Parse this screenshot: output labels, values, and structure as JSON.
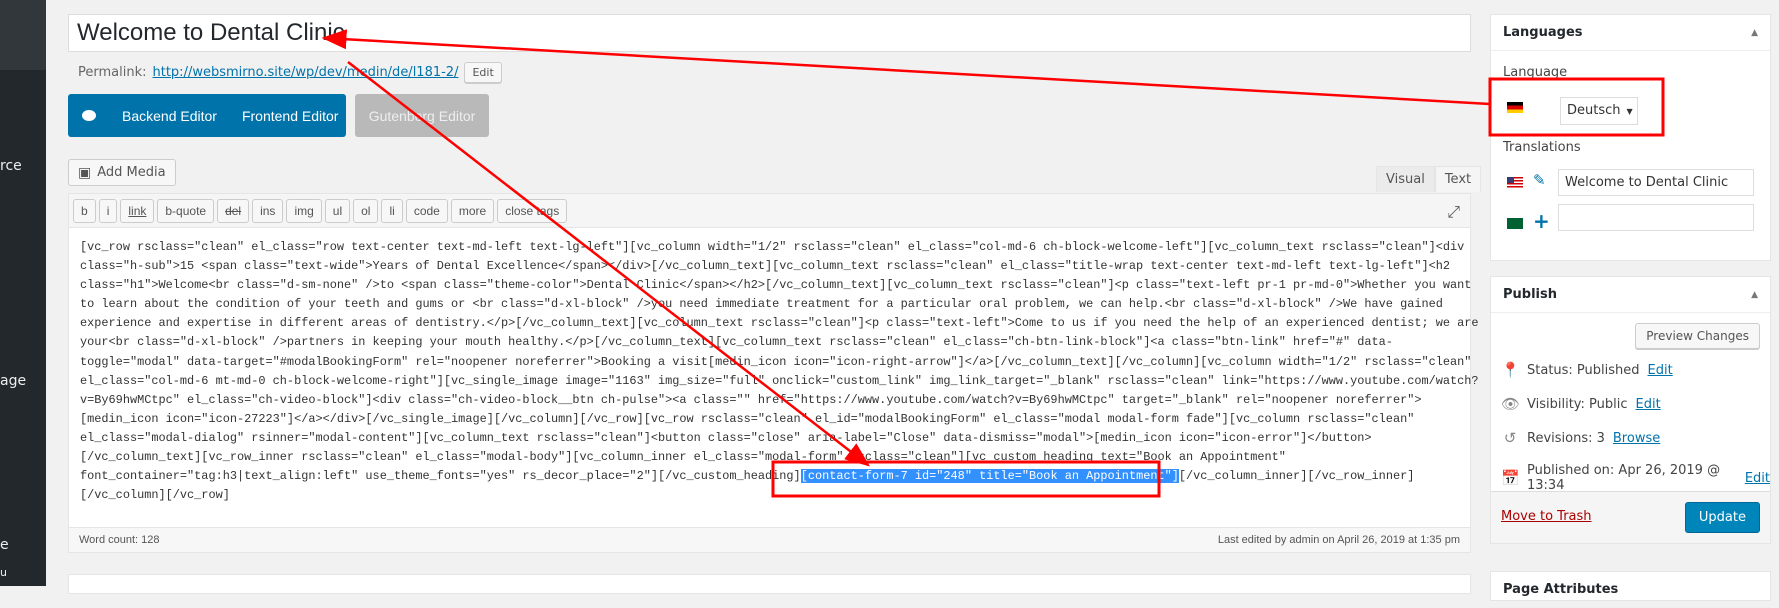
{
  "sidebar": {
    "partial_labels": [
      "rce",
      "age",
      "e",
      "u"
    ]
  },
  "title": {
    "value": "Welcome to Dental Clinic"
  },
  "permalink": {
    "label": "Permalink:",
    "url": "http://websmirno.site/wp/dev/medin/de/l181-2/",
    "edit": "Edit"
  },
  "composer": {
    "backend": "Backend Editor",
    "frontend": "Frontend Editor",
    "gutenberg": "Gutenberg Editor"
  },
  "add_media": "Add Media",
  "tabs": {
    "visual": "Visual",
    "text": "Text"
  },
  "quicktags": [
    "b",
    "i",
    "link",
    "b-quote",
    "del",
    "ins",
    "img",
    "ul",
    "ol",
    "li",
    "code",
    "more",
    "close tags"
  ],
  "content": {
    "lines": [
      "[vc_row rsclass=\"clean\" el_class=\"row text-center text-md-left text-lg-left\"][vc_column width=\"1/2\" rsclass=\"clean\" el_class=\"col-md-6 ch-block-welcome-left\"][vc_column_text rsclass=\"clean\"]<div",
      "class=\"h-sub\">15 <span class=\"text-wide\">Years of Dental Excellence</span></div>[/vc_column_text][vc_column_text rsclass=\"clean\" el_class=\"title-wrap text-center text-md-left text-lg-left\"]<h2",
      "class=\"h1\">Welcome<br class=\"d-sm-none\" />to <span class=\"theme-color\">Dental Clinic</span></h2>[/vc_column_text][vc_column_text rsclass=\"clean\"]<p class=\"text-left pr-1 pr-md-0\">Whether you want",
      "to learn about the condition of your teeth and gums or <br class=\"d-xl-block\" />you need immediate treatment for a particular oral problem, we can help.<br class=\"d-xl-block\" />We have gained",
      "experience and expertise in different areas of dentistry.</p>[/vc_column_text][vc_column_text rsclass=\"clean\"]<p class=\"text-left\">Come to us if you need the help of an experienced dentist; we are",
      "your<br class=\"d-xl-block\" />partners in keeping your mouth healthy.</p>[/vc_column_text][vc_column_text rsclass=\"clean\" el_class=\"ch-btn-link-block\"]<a class=\"btn-link\" href=\"#\" data-",
      "toggle=\"modal\" data-target=\"#modalBookingForm\" rel=\"noopener noreferrer\">Booking a visit[medin_icon icon=\"icon-right-arrow\"]</a>[/vc_column_text][/vc_column][vc_column width=\"1/2\" rsclass=\"clean\"",
      "el_class=\"col-md-6 mt-md-0 ch-block-welcome-right\"][vc_single_image image=\"1163\" img_size=\"full\" onclick=\"custom_link\" img_link_target=\"_blank\" rsclass=\"clean\" link=\"https://www.youtube.com/watch?",
      "v=By69hwMCtpc\" el_class=\"ch-video-block\"]<div class=\"ch-video-block__btn ch-pulse\"><a class=\"\" href=\"https://www.youtube.com/watch?v=By69hwMCtpc\" target=\"_blank\" rel=\"noopener noreferrer\">",
      "[medin_icon icon=\"icon-27223\"]</a></div>[/vc_single_image][/vc_column][/vc_row][vc_row rsclass=\"clean\" el_id=\"modalBookingForm\" el_class=\"modal modal-form fade\"][vc_column rsclass=\"clean\"",
      "el_class=\"modal-dialog\" rsinner=\"modal-content\"][vc_column_text rsclass=\"clean\"]<button class=\"close\" aria-label=\"Close\" data-dismiss=\"modal\">[medin_icon icon=\"icon-error\"]</button>",
      "[/vc_column_text][vc_row_inner rsclass=\"clean\" el_class=\"modal-body\"][vc_column_inner el_class=\"modal-form\" rsclass=\"clean\"][vc_custom_heading text=\"Book an Appointment\""
    ],
    "line13_before": "font_container=\"tag:h3|text_align:left\" use_theme_fonts=\"yes\" rs_decor_place=\"2\"][/vc_custom_heading]",
    "line13_selected": "[contact-form-7 id=\"248\" title=\"Book an Appointment\"]",
    "line13_after": "[/vc_column_inner][/vc_row_inner]",
    "line14": "[/vc_column][/vc_row]"
  },
  "footer": {
    "word_count": "Word count: 128",
    "last_edited": "Last edited by admin on April 26, 2019 at 1:35 pm"
  },
  "languages": {
    "title": "Languages",
    "language_label": "Language",
    "selected": "Deutsch",
    "translations_label": "Translations",
    "translation_en": "Welcome to Dental Clinic",
    "translation_other": ""
  },
  "publish": {
    "title": "Publish",
    "preview": "Preview Changes",
    "status": "Status: Published",
    "visibility": "Visibility: Public",
    "revisions": "Revisions: 3",
    "published_on": "Published on: Apr 26, 2019 @ 13:34",
    "edit": "Edit",
    "browse": "Browse",
    "trash": "Move to Trash",
    "update": "Update"
  },
  "page_attributes": {
    "title": "Page Attributes"
  },
  "colors": {
    "accent": "#0073aa",
    "annotation": "#ff0000",
    "selection": "#3390ff",
    "trash": "#a00"
  }
}
